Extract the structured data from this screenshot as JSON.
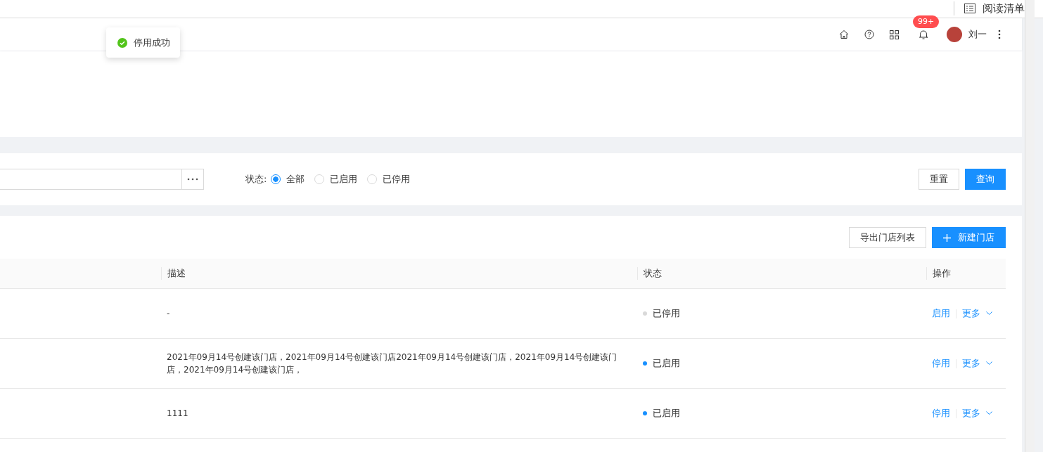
{
  "top_bar": {
    "reading_list": "阅读清单"
  },
  "header": {
    "notification_badge": "99+",
    "user_name": "刘一"
  },
  "toast": {
    "message": "停用成功"
  },
  "filter": {
    "status_label": "状态:",
    "options": [
      {
        "label": "全部",
        "selected": true
      },
      {
        "label": "已启用",
        "selected": false
      },
      {
        "label": "已停用",
        "selected": false
      }
    ],
    "buttons": [
      "重置",
      "查询"
    ]
  },
  "toolbar": {
    "export_button": "导出门店列表",
    "new_button": "新建门店"
  },
  "table": {
    "columns": [
      "描述",
      "状态",
      "操作"
    ],
    "rows": [
      {
        "description": "-",
        "enabled": false,
        "status": "已停用",
        "action": "启用",
        "more": "更多"
      },
      {
        "description": "2021年09月14号创建该门店，2021年09月14号创建该门店2021年09月14号创建该门店，2021年09月14号创建该门店，2021年09月14号创建该门店，",
        "enabled": true,
        "status": "已启用",
        "action": "停用",
        "more": "更多"
      },
      {
        "description": "1111",
        "enabled": true,
        "status": "已启用",
        "action": "停用",
        "more": "更多"
      }
    ]
  }
}
